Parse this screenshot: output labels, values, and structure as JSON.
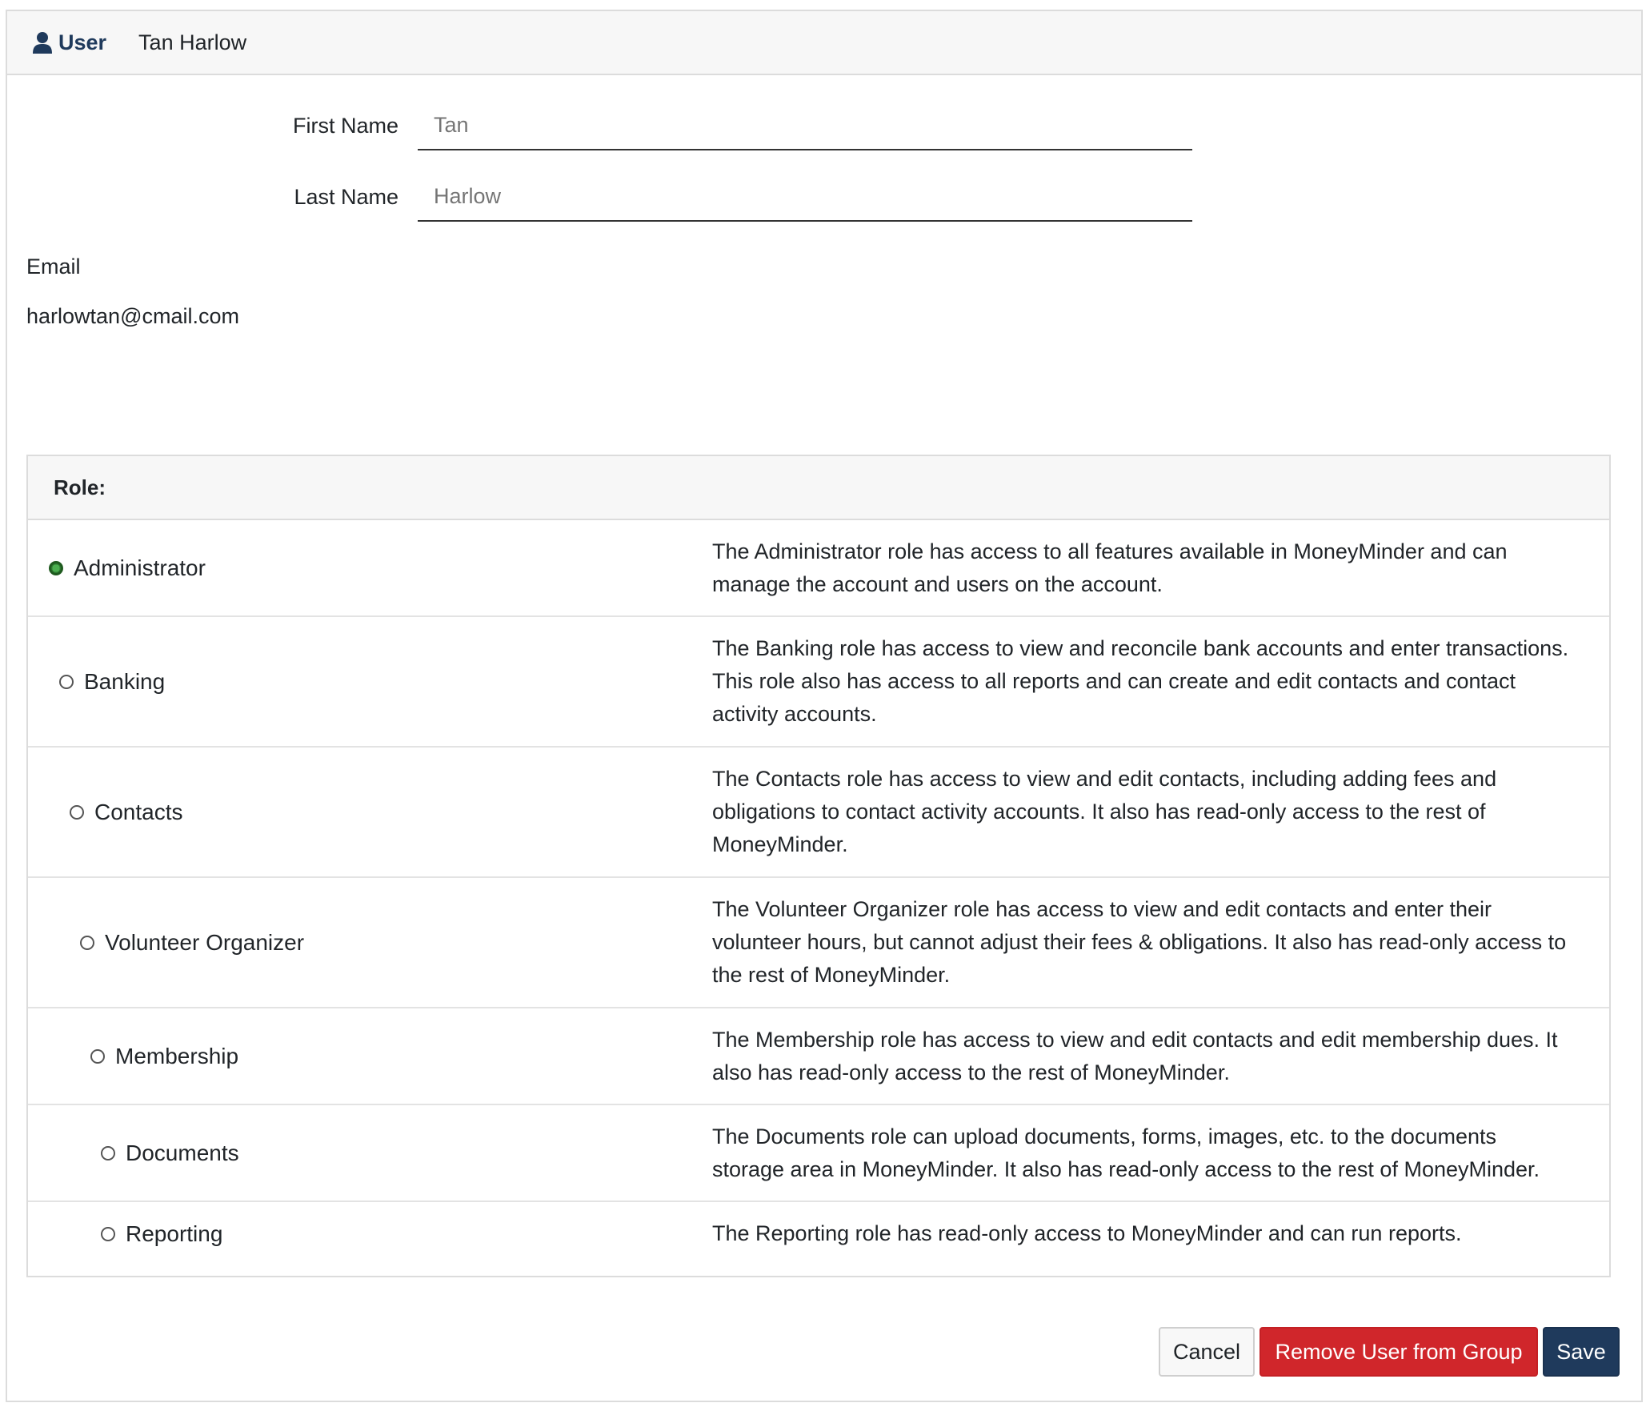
{
  "header": {
    "icon": "user-icon",
    "label": "User",
    "name": "Tan Harlow"
  },
  "form": {
    "first_name_label": "First Name",
    "first_name_placeholder": "Tan",
    "last_name_label": "Last Name",
    "last_name_placeholder": "Harlow",
    "email_label": "Email",
    "email_value": "harlowtan@cmail.com"
  },
  "roles": {
    "header": "Role:",
    "selected": "Administrator",
    "items": [
      {
        "name": "Administrator",
        "description": "The Administrator role has access to all features available in MoneyMinder and can manage the account and users on the account."
      },
      {
        "name": "Banking",
        "description": "The Banking role has access to view and reconcile bank accounts and enter transactions. This role also has access to all reports and can create and edit contacts and contact activity accounts."
      },
      {
        "name": "Contacts",
        "description": "The Contacts role has access to view and edit contacts, including adding fees and obligations to contact activity accounts. It also has read-only access to the rest of MoneyMinder."
      },
      {
        "name": "Volunteer Organizer",
        "description": "The Volunteer Organizer role has access to view and edit contacts and enter their volunteer hours, but cannot adjust their fees & obligations. It also has read-only access to the rest of MoneyMinder."
      },
      {
        "name": "Membership",
        "description": "The Membership role has access to view and edit contacts and edit membership dues. It also has read-only access to the rest of MoneyMinder."
      },
      {
        "name": "Documents",
        "description": "The Documents role can upload documents, forms, images, etc. to the documents storage area in MoneyMinder. It also has read-only access to the rest of MoneyMinder."
      },
      {
        "name": "Reporting",
        "description": "The Reporting role has read-only access to MoneyMinder and can run reports."
      }
    ]
  },
  "buttons": {
    "cancel": "Cancel",
    "remove": "Remove User from Group",
    "save": "Save"
  },
  "colors": {
    "primary": "#1f3a5c",
    "danger": "#d0262b",
    "selected_radio": "#4caf50"
  }
}
